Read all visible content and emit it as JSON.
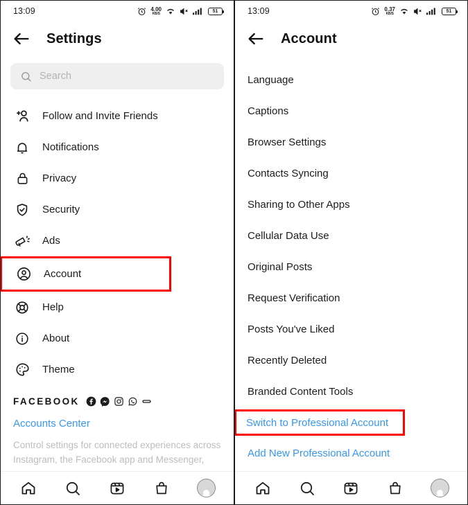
{
  "left": {
    "status": {
      "time": "13:09",
      "alarm_icon": "alarm-icon",
      "net_speed_value": "4.00",
      "net_speed_unit": "KB/S",
      "wifi_icon": "wifi-icon",
      "mute_icon": "mute-icon",
      "signal_icon": "signal-icon",
      "battery_level": "51"
    },
    "appbar": {
      "back_icon": "back-arrow-icon",
      "title": "Settings"
    },
    "search": {
      "icon": "search-icon",
      "placeholder": "Search",
      "value": ""
    },
    "items": [
      {
        "label": "Follow and Invite Friends",
        "icon": "person-add-icon",
        "highlighted": false
      },
      {
        "label": "Notifications",
        "icon": "bell-icon",
        "highlighted": false
      },
      {
        "label": "Privacy",
        "icon": "lock-icon",
        "highlighted": false
      },
      {
        "label": "Security",
        "icon": "shield-check-icon",
        "highlighted": false
      },
      {
        "label": "Ads",
        "icon": "megaphone-icon",
        "highlighted": false
      },
      {
        "label": "Account",
        "icon": "account-circle-icon",
        "highlighted": true
      },
      {
        "label": "Help",
        "icon": "lifebuoy-icon",
        "highlighted": false
      },
      {
        "label": "About",
        "icon": "info-circle-icon",
        "highlighted": false
      },
      {
        "label": "Theme",
        "icon": "palette-icon",
        "highlighted": false
      }
    ],
    "facebook": {
      "wordmark": "FACEBOOK",
      "app_icons": [
        "facebook-icon",
        "messenger-icon",
        "instagram-icon",
        "whatsapp-icon",
        "portal-icon"
      ],
      "accounts_center_label": "Accounts Center",
      "description": "Control settings for connected experiences across Instagram, the Facebook app and Messenger,"
    }
  },
  "right": {
    "status": {
      "time": "13:09",
      "alarm_icon": "alarm-icon",
      "net_speed_value": "0.37",
      "net_speed_unit": "KB/S",
      "wifi_icon": "wifi-icon",
      "mute_icon": "mute-icon",
      "signal_icon": "signal-icon",
      "battery_level": "51"
    },
    "appbar": {
      "back_icon": "back-arrow-icon",
      "title": "Account"
    },
    "items": [
      {
        "label": "Language",
        "link": false,
        "highlighted": false
      },
      {
        "label": "Captions",
        "link": false,
        "highlighted": false
      },
      {
        "label": "Browser Settings",
        "link": false,
        "highlighted": false
      },
      {
        "label": "Contacts Syncing",
        "link": false,
        "highlighted": false
      },
      {
        "label": "Sharing to Other Apps",
        "link": false,
        "highlighted": false
      },
      {
        "label": "Cellular Data Use",
        "link": false,
        "highlighted": false
      },
      {
        "label": "Original Posts",
        "link": false,
        "highlighted": false
      },
      {
        "label": "Request Verification",
        "link": false,
        "highlighted": false
      },
      {
        "label": "Posts You've Liked",
        "link": false,
        "highlighted": false
      },
      {
        "label": "Recently Deleted",
        "link": false,
        "highlighted": false
      },
      {
        "label": "Branded Content Tools",
        "link": false,
        "highlighted": false
      },
      {
        "label": "Switch to Professional Account",
        "link": true,
        "highlighted": true
      },
      {
        "label": "Add New Professional Account",
        "link": true,
        "highlighted": false
      }
    ]
  },
  "bottom_nav": {
    "items": [
      "home-icon",
      "search-icon",
      "reels-icon",
      "shop-icon",
      "profile-avatar"
    ]
  },
  "colors": {
    "link": "#3897f0",
    "highlight": "#ff0000",
    "text": "#1c1c1c",
    "muted": "#bdbdbd",
    "search_bg": "#efefef"
  }
}
